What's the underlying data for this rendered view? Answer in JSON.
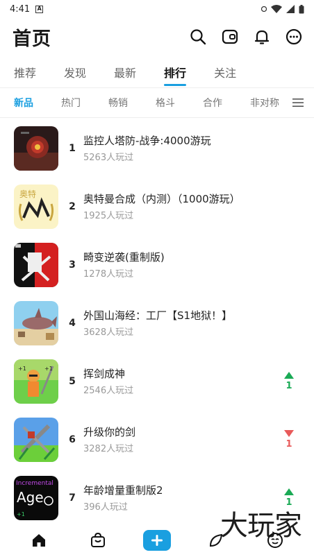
{
  "status_bar": {
    "time": "4:41",
    "notif_icon": "a-icon"
  },
  "header": {
    "title": "首页"
  },
  "main_tabs": [
    {
      "label": "推荐"
    },
    {
      "label": "发现"
    },
    {
      "label": "最新"
    },
    {
      "label": "排行",
      "active": true
    },
    {
      "label": "关注"
    }
  ],
  "sub_tabs": [
    {
      "label": "新品",
      "active": true
    },
    {
      "label": "热门"
    },
    {
      "label": "畅销"
    },
    {
      "label": "格斗"
    },
    {
      "label": "合作"
    },
    {
      "label": "非对称"
    }
  ],
  "games": [
    {
      "rank": "1",
      "title": "监控人塔防-战争:4000游玩",
      "players": "5263人玩过",
      "trend": null
    },
    {
      "rank": "2",
      "title": "奥特曼合成（内测）（1000游玩）",
      "players": "1925人玩过",
      "trend": null
    },
    {
      "rank": "3",
      "title": "畸变逆袭(重制版)",
      "players": "1278人玩过",
      "trend": null
    },
    {
      "rank": "4",
      "title": "外国山海经：工厂【S1地狱！】",
      "players": "3628人玩过",
      "trend": null
    },
    {
      "rank": "5",
      "title": "挥剑成神",
      "players": "2546人玩过",
      "trend": "up",
      "change": "1"
    },
    {
      "rank": "6",
      "title": "升级你的剑",
      "players": "3282人玩过",
      "trend": "down",
      "change": "1"
    },
    {
      "rank": "7",
      "title": "年龄增量重制版2",
      "players": "396人玩过",
      "trend": "up",
      "change": "1"
    }
  ],
  "watermark": "大玩家",
  "colors": {
    "accent": "#1a9fe0",
    "up": "#1aaa55",
    "down": "#e85a5a"
  }
}
